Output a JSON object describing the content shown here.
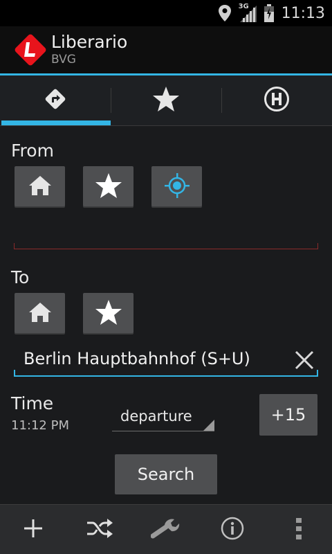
{
  "status_bar": {
    "time": "11:13",
    "network": "3G",
    "icons": [
      "location-icon",
      "signal-icon",
      "battery-icon"
    ]
  },
  "action_bar": {
    "title": "Liberario",
    "subtitle": "BVG",
    "logo_letter": "L"
  },
  "tabs": [
    {
      "icon": "directions-icon",
      "active": true
    },
    {
      "icon": "star-icon",
      "active": false
    },
    {
      "icon": "station-h-icon",
      "active": false,
      "glyph": "H"
    }
  ],
  "from": {
    "label": "From",
    "buttons": [
      "home-icon",
      "star-icon",
      "gps-icon"
    ],
    "value": ""
  },
  "to": {
    "label": "To",
    "buttons": [
      "home-icon",
      "star-icon"
    ],
    "value": "Berlin Hauptbahnhof (S+U)"
  },
  "time": {
    "label": "Time",
    "value": "11:12 PM",
    "mode": "departure",
    "plus_label": "+15"
  },
  "search": {
    "label": "Search"
  },
  "bottom_bar": [
    "add-icon",
    "shuffle-icon",
    "wrench-icon",
    "info-icon",
    "overflow-icon"
  ],
  "colors": {
    "accent": "#33b5e5",
    "logo_red": "#e8141c",
    "button_bg": "#4e4f51",
    "background": "#1a1b1d"
  }
}
